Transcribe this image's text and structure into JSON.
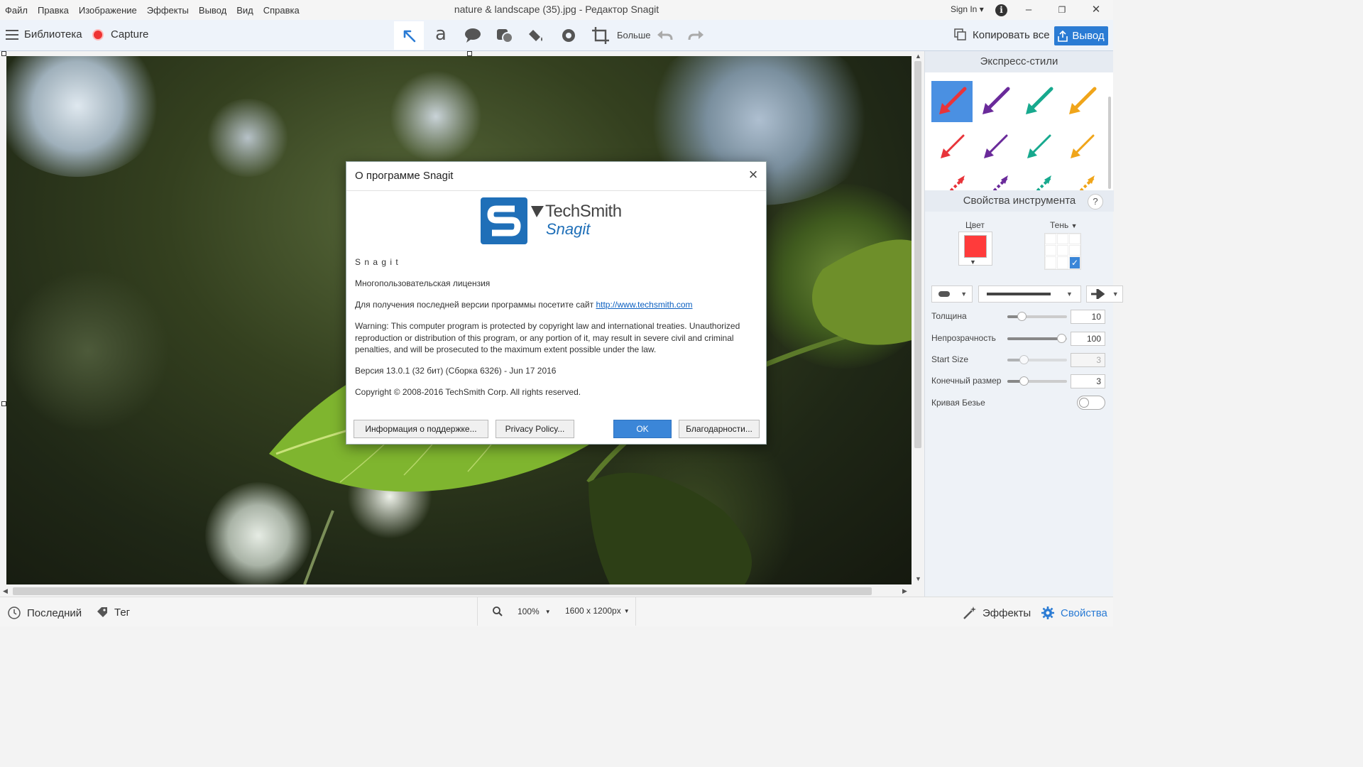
{
  "menu": [
    "Файл",
    "Правка",
    "Изображение",
    "Эффекты",
    "Вывод",
    "Вид",
    "Справка"
  ],
  "window_title": "nature & landscape (35).jpg - Редактор Snagit",
  "signin": "Sign In",
  "toolbar": {
    "library": "Библиотека",
    "capture": "Capture",
    "more": "Больше",
    "copy_all": "Копировать все",
    "share": "Вывод"
  },
  "quick_styles": {
    "title": "Экспресс-стили",
    "colors": [
      "#e8343a",
      "#6a2a9a",
      "#17a98e",
      "#f0a51a"
    ]
  },
  "tool_props": {
    "title": "Свойства инструмента",
    "color_label": "Цвет",
    "color_value": "#ff3b3b",
    "shadow_label": "Тень",
    "thickness_label": "Толщина",
    "thickness_value": "10",
    "opacity_label": "Непрозрачность",
    "opacity_value": "100",
    "start_size_label": "Start Size",
    "start_size_value": "3",
    "end_size_label": "Конечный размер",
    "end_size_value": "3",
    "bezier_label": "Кривая Безье"
  },
  "bottom": {
    "recent": "Последний",
    "tag": "Тег",
    "zoom": "100%",
    "dimensions": "1600 x 1200px",
    "effects": "Эффекты",
    "properties": "Свойства"
  },
  "dialog": {
    "title": "О программе Snagit",
    "logo_brand": "TechSmith",
    "logo_product": "Snagit",
    "product": "S n a g i t",
    "license": "Многопользовательская лицензия",
    "update_text": "Для получения последней версии программы посетите сайт ",
    "update_link": "http://www.techsmith.com",
    "warning": "Warning: This computer program is protected by copyright law and international treaties. Unauthorized reproduction or distribution of this program, or any portion of it, may result in severe civil and criminal penalties, and will be prosecuted to the maximum extent possible under the law.",
    "version": "Версия 13.0.1 (32 бит) (Сборка 6326) - Jun 17 2016",
    "copyright": "Copyright © 2008-2016 TechSmith Corp. All rights reserved.",
    "btn_support": "Информация о поддержке...",
    "btn_privacy": "Privacy Policy...",
    "btn_ok": "OK",
    "btn_thanks": "Благодарности..."
  }
}
